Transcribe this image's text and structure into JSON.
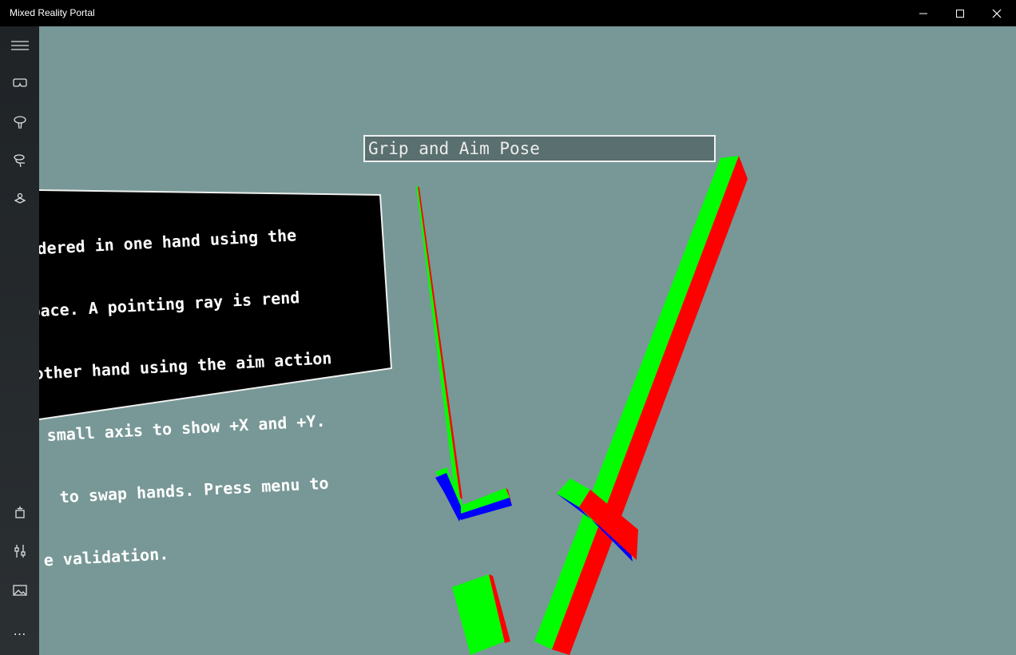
{
  "window": {
    "title": "Mixed Reality Portal",
    "controls": {
      "minimize": "minimize-icon",
      "maximize": "maximize-icon",
      "close": "close-icon"
    }
  },
  "sidebar": {
    "top_icons": [
      "hamburger-menu-icon",
      "headset-icon",
      "hand-controller-icon",
      "controllers-icon",
      "boundary-icon"
    ],
    "bottom_icons": [
      "holograms-icon",
      "settings-icon",
      "photos-icon",
      "more-icon"
    ],
    "more_label": "…"
  },
  "scene": {
    "pose_title": "Grip and Aim Pose",
    "instructions": [
      "ndered in one hand using the",
      "pace. A pointing ray is rend",
      "other hand using the aim action",
      " small axis to show +X and +Y.",
      "  to swap hands. Press menu to",
      "e validation."
    ],
    "colors": {
      "background": "#779896",
      "x_axis": "#ff0000",
      "y_axis": "#00ff00",
      "z_axis": "#0000ff"
    }
  }
}
